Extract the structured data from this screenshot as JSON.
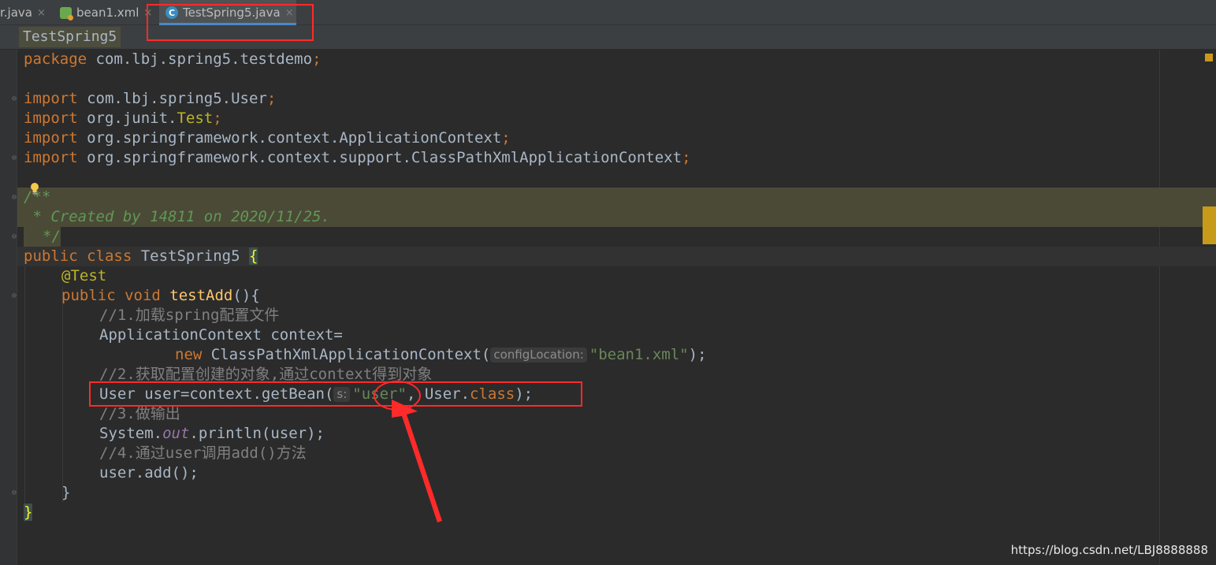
{
  "tabs": [
    {
      "label": "r.java",
      "close": "×"
    },
    {
      "label": "bean1.xml",
      "close": "×"
    },
    {
      "label": "TestSpring5.java",
      "close": "×",
      "icon_letter": "C"
    }
  ],
  "breadcrumb": "TestSpring5",
  "code": {
    "pkg_kw": "package",
    "pkg_name": " com.lbj.spring5.testdemo",
    "semi": ";",
    "import_kw": "import",
    "imp1": " com.lbj.spring5.User",
    "imp2a": " org.junit.",
    "imp2b": "Test",
    "imp3": " org.springframework.context.ApplicationContext",
    "imp4": " org.springframework.context.support.ClassPathXmlApplicationContext",
    "doc_open": "/**",
    "doc_body": " * Created by 14811 on 2020/11/25.",
    "doc_close": "*/",
    "cls_kw": "public class",
    "cls_name": " TestSpring5 ",
    "brace_open": "{",
    "ann": "@Test",
    "m_kw": "public void",
    "m_name": "testAdd",
    "m_rest": "(){",
    "c1": "//1.加载spring配置文件",
    "l5": "ApplicationContext context=",
    "new_kw": "new",
    "l6_cls": " ClassPathXmlApplicationContext(",
    "hint1": "configLocation:",
    "l6_str": "\"bean1.xml\"",
    "l6_end": ");",
    "c2": "//2.获取配置创建的对象,通过context得到对象",
    "l8a": "User user=context.getBean(",
    "hint2": "s:",
    "l8_str": "\"user\"",
    "l8b": ", User.",
    "l8_kw": "class",
    "l8_end": ");",
    "c3": "//3.做输出",
    "l10a": "System.",
    "l10_fld": "out",
    "l10b": ".println(user);",
    "c4": "//4.通过user调用add()方法",
    "l12": "user.add();",
    "close_m": "}",
    "close_c": "}"
  },
  "watermark": "https://blog.csdn.net/LBJ8888888",
  "colors": {
    "annotation_red": "#ff2a2a",
    "accent": "#4a88c7"
  }
}
